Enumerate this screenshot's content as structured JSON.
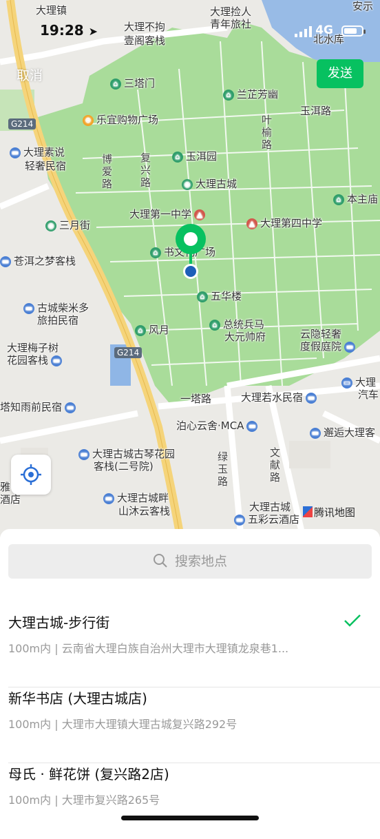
{
  "status": {
    "time": "19:28",
    "network": "4G"
  },
  "header": {
    "cancel_label": "取消",
    "send_label": "发送"
  },
  "map": {
    "labels": [
      "大理镇",
      "大理不拘",
      "壹阁客栈",
      "大理捡人",
      "青年旅社",
      "北水库",
      "安示",
      "三塔门",
      "兰芷芳幽",
      "乐宜购物广场",
      "玉洱路",
      "叶榆路",
      "大理素说",
      "轻奢民宿",
      "玉洱园",
      "博爱路",
      "复兴路",
      "大理古城",
      "本主庙",
      "大理第一中学",
      "大理第四中学",
      "三月街",
      "书文化广场",
      "苍洱之梦客栈",
      "五华楼",
      "古城柴米多",
      "旅拍民宿",
      "风月",
      "总统兵马",
      "大元帅府",
      "云隐轻奢",
      "度假庭院",
      "大理梅子树",
      "花园客栈",
      "大理",
      "汽车",
      "一塔路",
      "大理若水民宿",
      "塔知雨前民宿",
      "泊心云舍·MCA",
      "邂逅大理客",
      "绿玉路",
      "文献路",
      "大理古城古琴花园",
      "客栈(二号院)",
      "雅",
      "酒店",
      "大理古城畔",
      "山沐云客栈",
      "大理古城",
      "五彩云酒店"
    ],
    "road_badges": [
      "G214",
      "G214"
    ],
    "attribution": "腾讯地图"
  },
  "search": {
    "placeholder": "搜索地点"
  },
  "results": [
    {
      "name": "大理古城-步行街",
      "address": "100m内 | 云南省大理白族自治州大理市大理镇龙泉巷1...",
      "selected": true
    },
    {
      "name": "新华书店 (大理古城店)",
      "address": "100m内 | 大理市大理镇大理古城复兴路292号",
      "selected": false
    },
    {
      "name": "母氏 · 鲜花饼 (复兴路2店)",
      "address": "100m内 | 大理市复兴路265号",
      "selected": false
    }
  ],
  "colors": {
    "accent": "#07c160",
    "park": "#a9dc9a",
    "road_major": "#f5d47a"
  }
}
